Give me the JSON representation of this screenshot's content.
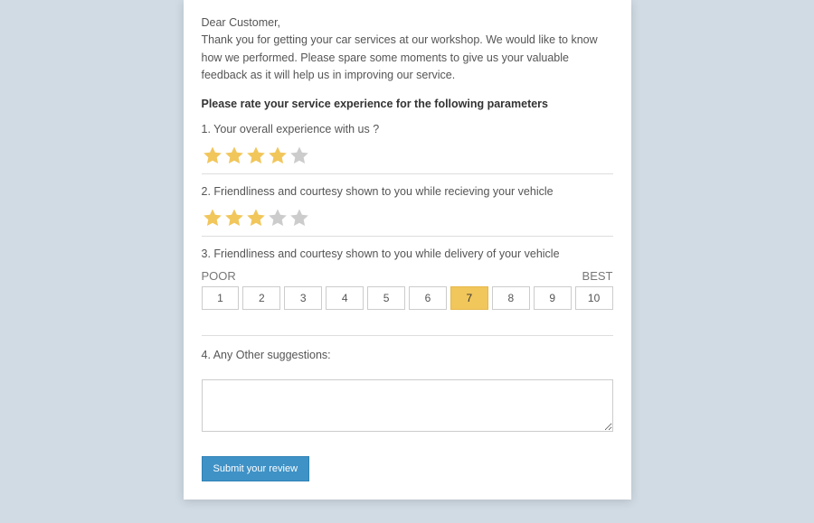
{
  "intro": {
    "greeting": "Dear Customer,",
    "body": "Thank you for getting your car services at our workshop. We would like to know how we performed. Please spare some moments to give us your valuable feedback as it will help us in improving our service."
  },
  "heading": "Please rate your service experience for the following parameters",
  "questions": {
    "q1": {
      "label": "1. Your overall experience with us ?",
      "stars": [
        true,
        true,
        true,
        true,
        false
      ]
    },
    "q2": {
      "label": "2. Friendliness and courtesy shown to you while recieving your vehicle",
      "stars": [
        true,
        true,
        true,
        false,
        false
      ]
    },
    "q3": {
      "label": "3. Friendliness and courtesy shown to you while delivery of your vehicle",
      "scale_min_label": "POOR",
      "scale_max_label": "BEST",
      "options": [
        "1",
        "2",
        "3",
        "4",
        "5",
        "6",
        "7",
        "8",
        "9",
        "10"
      ],
      "selected": "7"
    },
    "q4": {
      "label": "4. Any Other suggestions:",
      "value": ""
    }
  },
  "colors": {
    "star_filled": "#f1c65b",
    "star_empty": "#cccccc",
    "accent": "#3f92c6"
  },
  "submit_label": "Submit your review"
}
